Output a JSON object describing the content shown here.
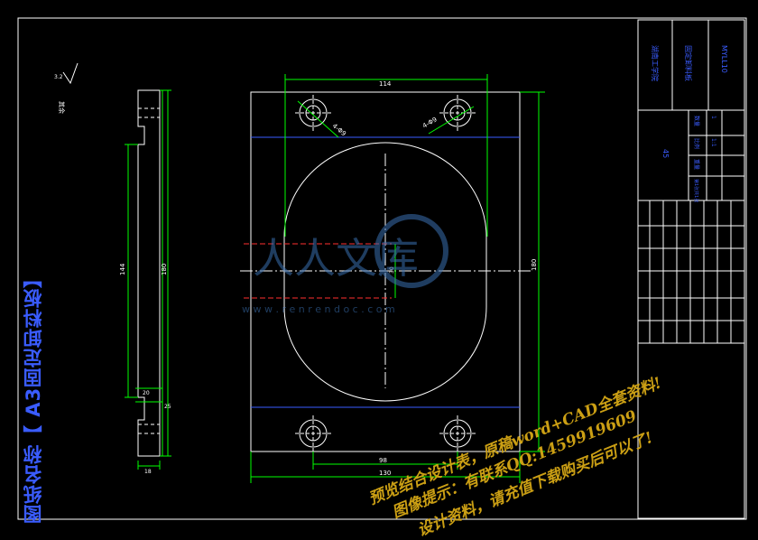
{
  "drawing": {
    "title": "图纸名称【 A3固定卸料板】",
    "surface_symbol_value": "3.2",
    "surface_note": "其余"
  },
  "title_block": {
    "college": "湖南工学院",
    "part_name": "固定卸料板",
    "drawing_no": "MYLL10",
    "material": "45",
    "qty_label": "数量",
    "qty_value": "1",
    "scale_label": "比例",
    "scale_value": "1:1",
    "weight_label": "重量",
    "sheet_label": "第1张共1张"
  },
  "dimensions": {
    "top_width": "114",
    "hole_left": "4-Φ9",
    "hole_right": "4-Φ9",
    "left_height_a": "144",
    "left_height_b": "180",
    "right_height": "180",
    "center_small": "30",
    "bottom_a": "98",
    "bottom_b": "130",
    "side_small_a": "20",
    "side_small_b": "25",
    "side_bottom": "18"
  },
  "watermark": {
    "logo_text": "人人文库",
    "logo_url": "w w w . r e n r e n d o c . c o m",
    "line1": "预览结合设计表，原稿word+CAD全套资料!",
    "line2": "图像提示：有联系QQ:1459919609",
    "line3": "设计资料，请充值下载购买后可以了!"
  }
}
